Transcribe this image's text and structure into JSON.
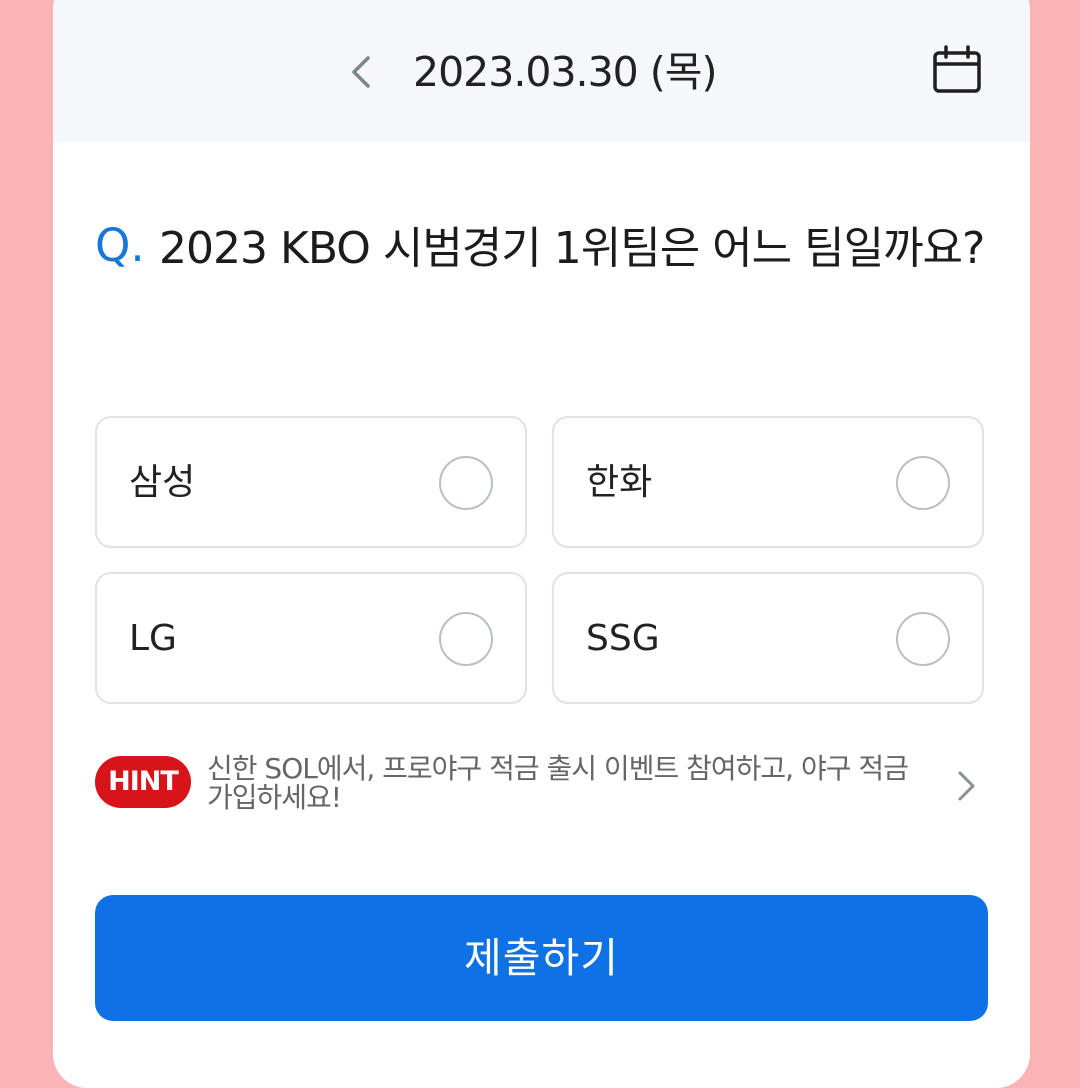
{
  "header": {
    "date": "2023.03.30 (목)",
    "prev_icon": "chevron-left-icon",
    "calendar_icon": "calendar-icon"
  },
  "question": {
    "prefix": "Q.",
    "text": "2023 KBO 시범경기 1위팀은 어느 팀일까요?"
  },
  "options": [
    {
      "label": "삼성",
      "selected": false
    },
    {
      "label": "한화",
      "selected": false
    },
    {
      "label": "LG",
      "selected": false
    },
    {
      "label": "SSG",
      "selected": false
    }
  ],
  "hint": {
    "badge": "HINT",
    "text": "신한 SOL에서, 프로야구 적금 출시 이벤트 참여하고, 야구 적금 가입하세요!",
    "arrow_icon": "chevron-right-icon"
  },
  "submit": {
    "label": "제출하기"
  },
  "colors": {
    "background": "#fbb4b6",
    "accent": "#0e72e6",
    "hint_badge": "#d7141a",
    "question_mark": "#1878d8"
  }
}
